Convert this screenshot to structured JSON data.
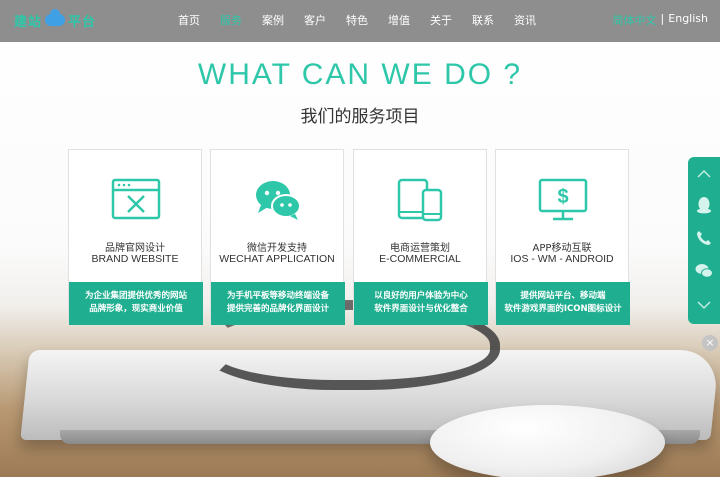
{
  "header": {
    "logo": {
      "left": "建站",
      "right": "平台"
    },
    "nav": [
      "首页",
      "服务",
      "案例",
      "客户",
      "特色",
      "增值",
      "关于",
      "联系",
      "资讯"
    ],
    "active_index": 1,
    "lang": {
      "cn": "简体中文",
      "sep": "|",
      "en": "English"
    }
  },
  "section": {
    "title": "WHAT CAN WE DO ?",
    "subtitle": "我们的服务项目"
  },
  "services": [
    {
      "icon": "website-design-icon",
      "cn": "品牌官网设计",
      "en": "BRAND WEBSITE",
      "desc1": "为企业集团提供优秀的网站",
      "desc2": "品牌形象，现实商业价值"
    },
    {
      "icon": "wechat-icon",
      "cn": "微信开发支持",
      "en": "WECHAT APPLICATION",
      "desc1": "为手机平板等移动终端设备",
      "desc2": "提供完善的品牌化界面设计"
    },
    {
      "icon": "mobile-tablet-icon",
      "cn": "电商运营策划",
      "en": "E-COMMERCIAL",
      "desc1": "以良好的用户体验为中心",
      "desc2": "软件界面设计与优化整合"
    },
    {
      "icon": "monitor-dollar-icon",
      "cn": "APP移动互联",
      "en": "IOS - WM - ANDROID",
      "desc1": "提供网站平台、移动端",
      "desc2": "软件游戏界面的ICON图标设计"
    }
  ],
  "colors": {
    "accent": "#2ec7a9",
    "accent_dark": "#1fae8f",
    "header_bg": "#6e6e6e"
  },
  "side_panel": [
    "chevron-up-icon",
    "qq-icon",
    "phone-icon",
    "wechat-icon",
    "chevron-down-icon"
  ],
  "close": "×"
}
